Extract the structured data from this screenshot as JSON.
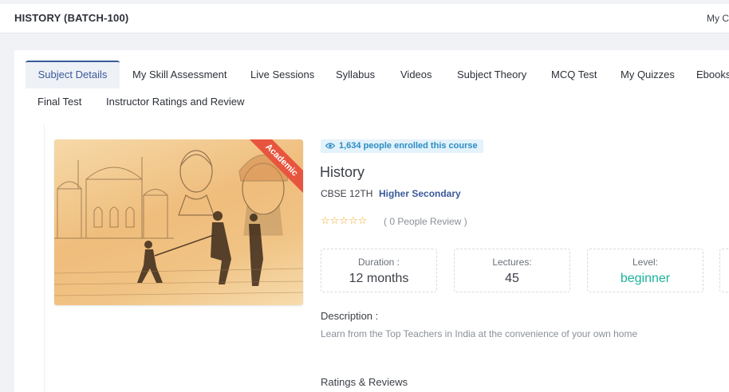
{
  "header": {
    "title": "HISTORY (BATCH-100)",
    "right_link": "My C"
  },
  "tabs": [
    {
      "label": "Subject Details",
      "active": true
    },
    {
      "label": "My Skill Assessment"
    },
    {
      "label": "Live Sessions"
    },
    {
      "label": "Syllabus"
    },
    {
      "label": "Videos"
    },
    {
      "label": "Subject Theory"
    },
    {
      "label": "MCQ Test"
    },
    {
      "label": "My Quizzes"
    },
    {
      "label": "Ebooks"
    },
    {
      "label": "Final Test"
    },
    {
      "label": "Instructor Ratings and Review"
    }
  ],
  "course": {
    "ribbon": "Academic",
    "enrolled": "1,634 people enrolled this course",
    "name": "History",
    "board": "CBSE 12TH",
    "level_group": "Higher Secondary",
    "rating": 0,
    "stars": "☆☆☆☆☆",
    "review_count": "( 0 People Review )",
    "stats": {
      "duration_label": "Duration :",
      "duration_value": "12 months",
      "lectures_label": "Lectures:",
      "lectures_value": "45",
      "level_label": "Level:",
      "level_value": "beginner"
    },
    "description_title": "Description :",
    "description": "Learn from the Top Teachers in India at the convenience of your own home",
    "ratings_title": "Ratings & Reviews"
  },
  "colors": {
    "accent": "#3b5a9a",
    "level_green": "#1bb39a",
    "star": "#f5a623",
    "ribbon": "#e8553f",
    "badge_text": "#2c8dc4"
  }
}
